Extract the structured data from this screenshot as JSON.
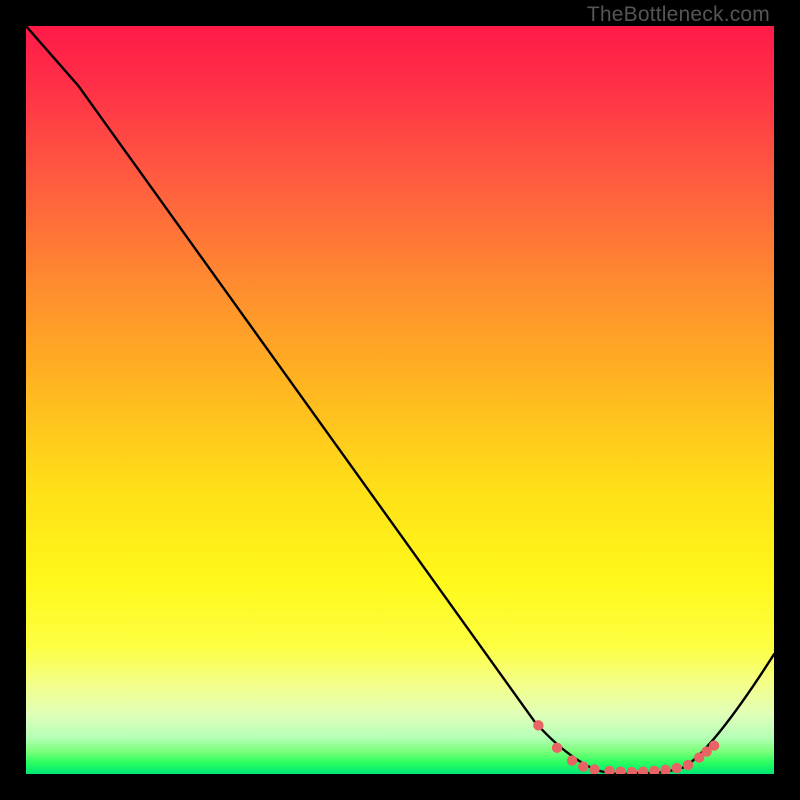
{
  "watermark": "TheBottleneck.com",
  "chart_data": {
    "type": "line",
    "title": "",
    "xlabel": "",
    "ylabel": "",
    "xlim": [
      0,
      100
    ],
    "ylim": [
      0,
      100
    ],
    "series": [
      {
        "name": "curve",
        "points": [
          {
            "x": 0,
            "y": 100
          },
          {
            "x": 7,
            "y": 92
          },
          {
            "x": 68,
            "y": 7
          },
          {
            "x": 72,
            "y": 2.5
          },
          {
            "x": 76,
            "y": 0.6
          },
          {
            "x": 82,
            "y": 0.2
          },
          {
            "x": 88,
            "y": 0.9
          },
          {
            "x": 92,
            "y": 3.5
          },
          {
            "x": 100,
            "y": 16
          }
        ]
      }
    ],
    "markers": [
      {
        "x": 68.5,
        "y": 6.5
      },
      {
        "x": 71,
        "y": 3.5
      },
      {
        "x": 73,
        "y": 1.8
      },
      {
        "x": 74.5,
        "y": 1.0
      },
      {
        "x": 76,
        "y": 0.6
      },
      {
        "x": 78,
        "y": 0.4
      },
      {
        "x": 79.5,
        "y": 0.3
      },
      {
        "x": 81,
        "y": 0.25
      },
      {
        "x": 82.5,
        "y": 0.3
      },
      {
        "x": 84,
        "y": 0.4
      },
      {
        "x": 85.5,
        "y": 0.55
      },
      {
        "x": 87,
        "y": 0.8
      },
      {
        "x": 88.5,
        "y": 1.2
      },
      {
        "x": 90,
        "y": 2.2
      },
      {
        "x": 91,
        "y": 3.0
      },
      {
        "x": 92,
        "y": 3.8
      }
    ],
    "marker_color": "#e86464",
    "line_color": "#000000"
  }
}
